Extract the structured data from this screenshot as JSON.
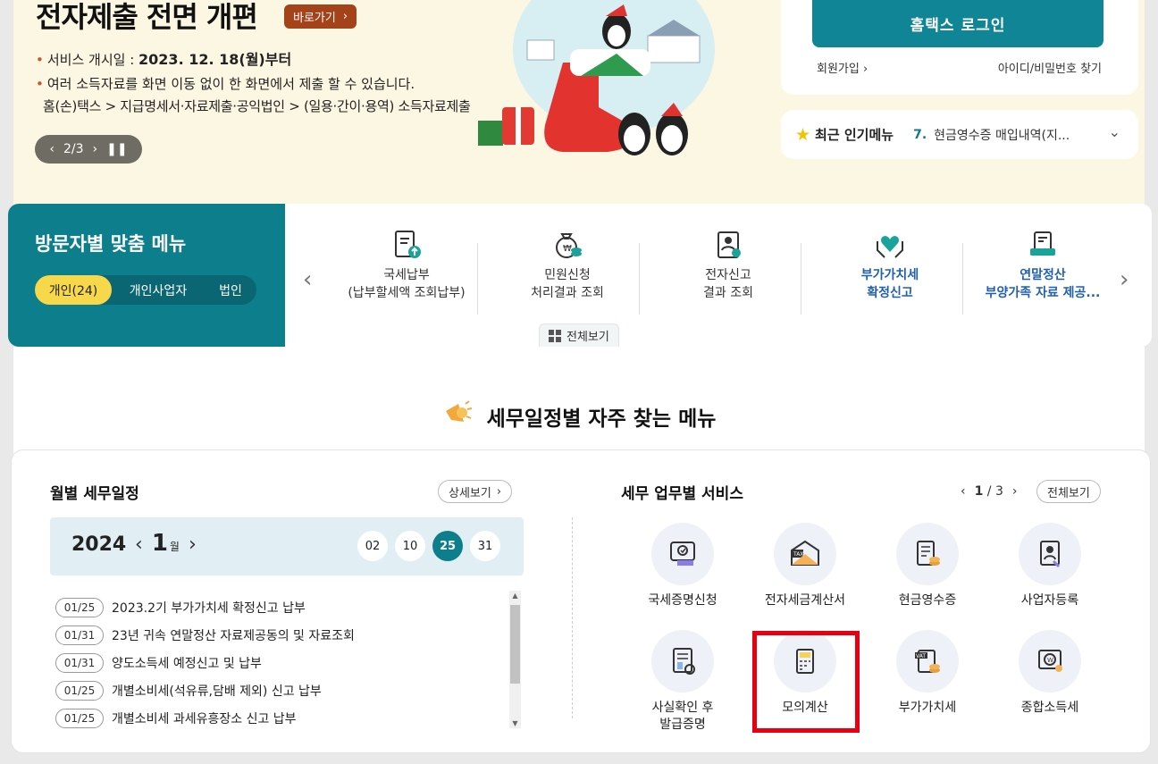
{
  "banner": {
    "title": "전자제출 전면 개편",
    "go_label": "바로가기",
    "line1_prefix": "서비스 개시일 :",
    "line1_date": "2023. 12. 18(월)부터",
    "line2": "여러 소득자료를 화면 이동 없이 한 화면에서 제출 할 수 있습니다.",
    "line3": "홈(손)택스 > 지급명세서·자료제출·공익법인 > (일용·간이·용역) 소득자료제출",
    "pager": "2/3"
  },
  "login": {
    "button": "홈택스 로그인",
    "join": "회원가입",
    "find": "아이디/비밀번호 찾기"
  },
  "popular": {
    "title": "최근 인기메뉴",
    "number": "7.",
    "text": "현금영수증 매입내역(지..."
  },
  "visitor": {
    "title": "방문자별 맞춤 메뉴",
    "tabs": [
      "개인(24)",
      "개인사업자",
      "법인"
    ],
    "items": [
      {
        "line1": "국세납부",
        "line2": "(납부할세액 조회납부)"
      },
      {
        "line1": "민원신청",
        "line2": "처리결과 조회"
      },
      {
        "line1": "전자신고",
        "line2": "결과 조회"
      },
      {
        "line1": "부가가치세",
        "line2": "확정신고"
      },
      {
        "line1": "연말정산",
        "line2": "부양가족 자료 제공..."
      }
    ],
    "all_view": "전체보기"
  },
  "section": {
    "title": "세무일정별 자주 찾는 메뉴"
  },
  "schedule": {
    "title": "월별 세무일정",
    "detail": "상세보기",
    "year": "2024",
    "month": "1",
    "month_unit": "월",
    "days": [
      "02",
      "10",
      "25",
      "31"
    ],
    "selected_day": "25",
    "items": [
      {
        "date": "01/25",
        "text": "2023.2기 부가가치세 확정신고 납부"
      },
      {
        "date": "01/31",
        "text": "23년 귀속 연말정산 자료제공동의 및 자료조회"
      },
      {
        "date": "01/31",
        "text": "양도소득세 예정신고 및 납부"
      },
      {
        "date": "01/25",
        "text": "개별소비세(석유류,담배 제외) 신고 납부"
      },
      {
        "date": "01/25",
        "text": "개별소비세 과세유흥장소 신고 납부"
      }
    ]
  },
  "services": {
    "title": "세무 업무별 서비스",
    "page_current": "1",
    "page_total": "3",
    "all_view": "전체보기",
    "items": [
      {
        "line1": "국세증명신청",
        "line2": "",
        "icon": "certificate-icon"
      },
      {
        "line1": "전자세금계산서",
        "line2": "",
        "icon": "tax-invoice-icon"
      },
      {
        "line1": "현금영수증",
        "line2": "",
        "icon": "cash-receipt-icon"
      },
      {
        "line1": "사업자등록",
        "line2": "",
        "icon": "business-registration-icon"
      },
      {
        "line1": "사실확인 후",
        "line2": "발급증명",
        "icon": "fact-check-icon"
      },
      {
        "line1": "모의계산",
        "line2": "",
        "icon": "calculator-icon"
      },
      {
        "line1": "부가가치세",
        "line2": "",
        "icon": "vat-icon"
      },
      {
        "line1": "종합소득세",
        "line2": "",
        "icon": "income-tax-icon"
      }
    ]
  },
  "colors": {
    "teal": "#0d7f8c",
    "highlight": "#e60012",
    "banner_bg": "#fcf7e2"
  }
}
